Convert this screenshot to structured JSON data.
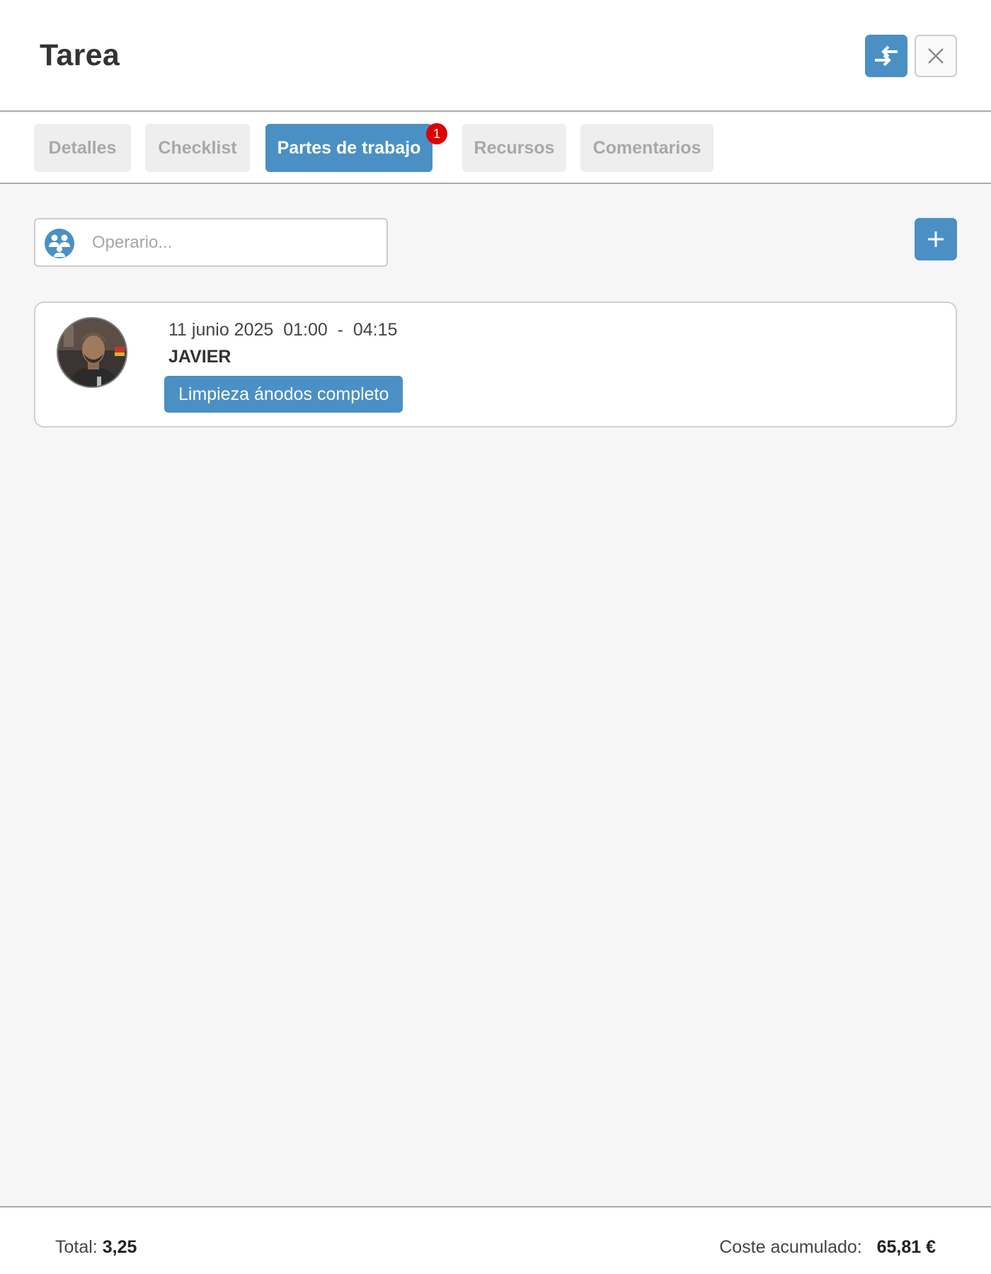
{
  "header": {
    "title": "Tarea"
  },
  "icons": {
    "swap": "swap-arrows-icon",
    "close": "close-icon",
    "operator": "operator-group-icon",
    "add": "plus-icon"
  },
  "tabs": [
    {
      "label": "Detalles",
      "active": false
    },
    {
      "label": "Checklist",
      "active": false
    },
    {
      "label": "Partes de trabajo",
      "active": true,
      "badge": "1"
    },
    {
      "label": "Recursos",
      "active": false
    },
    {
      "label": "Comentarios",
      "active": false
    }
  ],
  "filter": {
    "placeholder": "Operario...",
    "value": ""
  },
  "entries": [
    {
      "date": "11 junio 2025",
      "start": "01:00",
      "end": "04:15",
      "operator": "JAVIER",
      "task": "Limpieza ánodos completo"
    }
  ],
  "footer": {
    "total_label": "Total:",
    "total_value": "3,25",
    "coste_label": "Coste acumulado:",
    "coste_value": "65,81 €"
  },
  "colors": {
    "accent": "#4a90c4",
    "badge": "#dd0000",
    "background": "#f6f6f6",
    "tab_inactive_bg": "#eeeeee",
    "tab_inactive_text": "#a8a8a8"
  }
}
